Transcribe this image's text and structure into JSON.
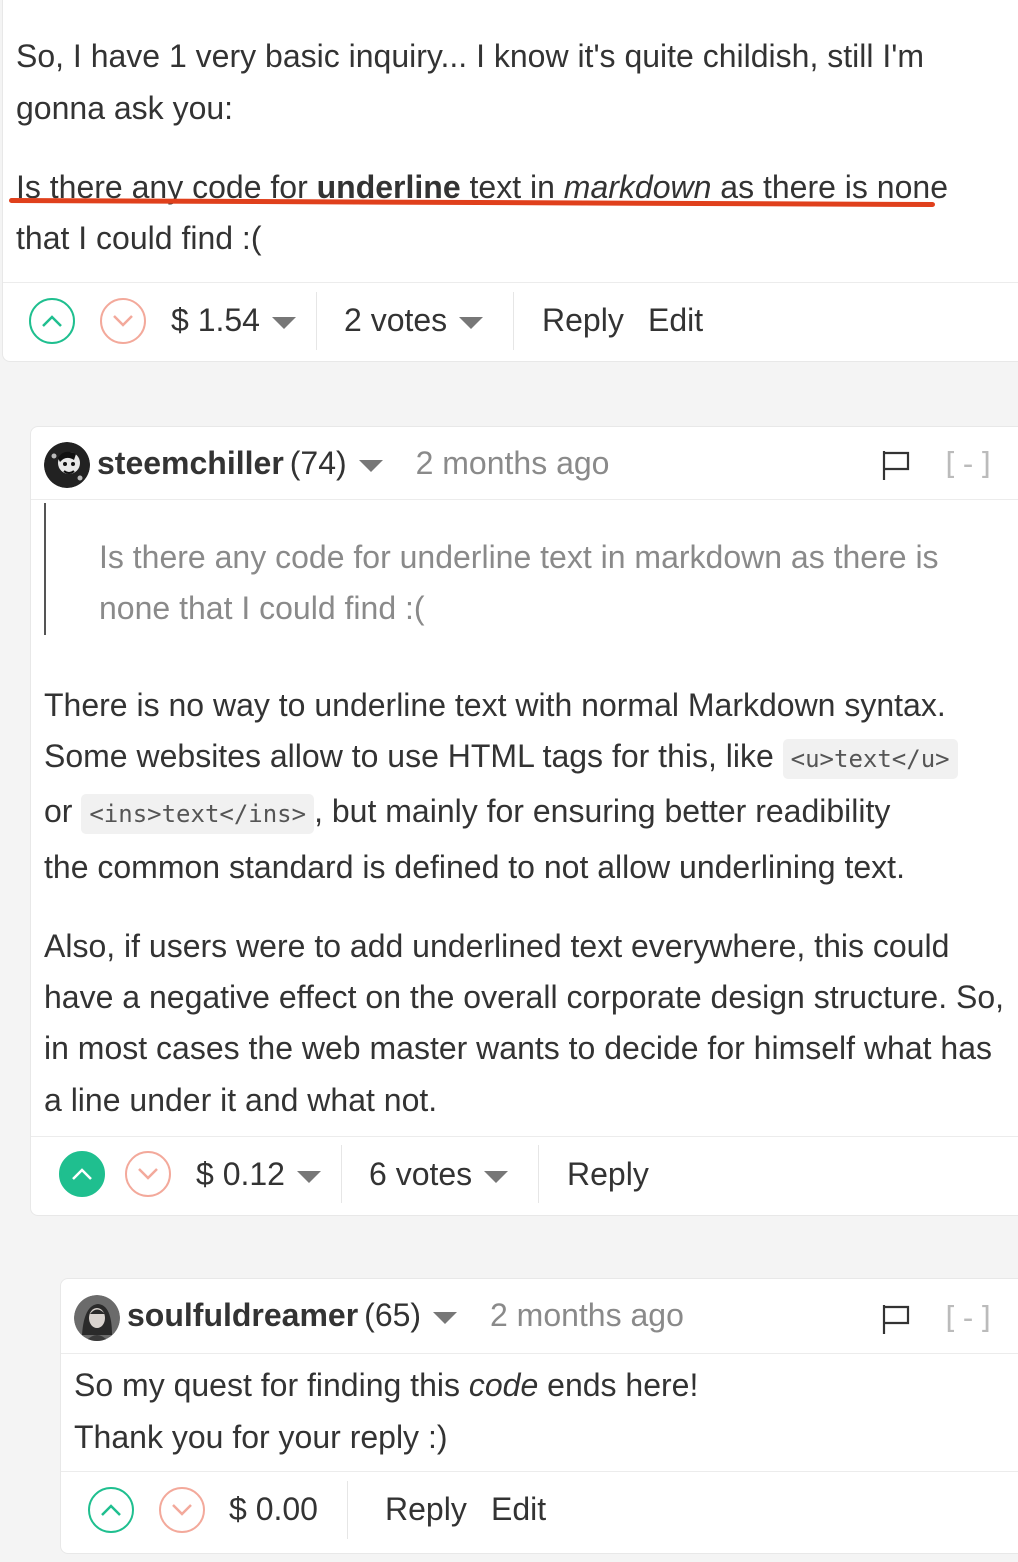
{
  "post": {
    "line1": "So, I have 1 very basic inquiry... I know it's quite childish, still I'm",
    "line2": "gonna ask you:",
    "q_a": "Is there any code for ",
    "q_bold": "underline",
    "q_b": " text in ",
    "q_it": "markdown",
    "q_c": " as there is none",
    "q_line2": "that I could find :(",
    "payout": "$ 1.54",
    "votes": "2 votes",
    "reply": "Reply",
    "edit": "Edit"
  },
  "comment1": {
    "author": "steemchiller",
    "rep": "(74)",
    "time": "2 months ago",
    "collapse": "[-]",
    "quote_line1": "Is there any code for underline text in markdown as there is",
    "quote_line2": "none that I could find :(",
    "p1_line1": "There is no way to underline text with normal Markdown syntax.",
    "p1_line2": "Some websites allow to use HTML tags for this, like ",
    "code1": "<u>text</u>",
    "p1_or": "or ",
    "code2": "<ins>text</ins>",
    "p1_line3_rest": ", but mainly for ensuring better readibility",
    "p1_line4": "the common standard is defined to not allow underlining text.",
    "p2_line1": "Also, if users were to add underlined text everywhere, this could",
    "p2_line2": "have a negative effect on the overall corporate design structure. So,",
    "p2_line3": "in most cases the web master wants to decide for himself what has",
    "p2_line4": "a line under it and what not.",
    "payout": "$ 0.12",
    "votes": "6 votes",
    "reply": "Reply"
  },
  "comment2": {
    "author": "soulfuldreamer",
    "rep": "(65)",
    "time": "2 months ago",
    "collapse": "[-]",
    "line1_a": "So my quest for finding this ",
    "line1_it": "code",
    "line1_b": " ends here!",
    "line2": "Thank you for your reply :)",
    "payout": "$ 0.00",
    "reply": "Reply",
    "edit": "Edit"
  },
  "colors": {
    "upvote": "#1fbf8f",
    "downvote": "#f3a99b",
    "underline_mark": "#e0401c",
    "card_bg": "#ffffff",
    "page_bg": "#f4f4f4"
  }
}
